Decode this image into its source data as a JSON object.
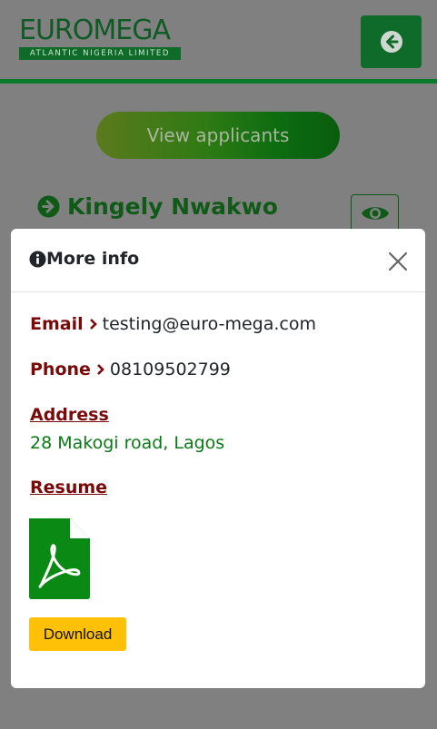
{
  "header": {
    "logo_main_1": "EURO",
    "logo_main_2": "MEGA",
    "logo_sub": "ATLANTIC NIGERIA LIMITED",
    "back_icon": "arrow-left-circle-icon"
  },
  "main": {
    "view_applicants_label": "View applicants",
    "applicant_name": "Kingely Nwakwo",
    "applicant_icon": "arrow-right-circle-icon",
    "view_icon": "eye-icon"
  },
  "modal": {
    "title": "More info",
    "title_icon": "info-circle-icon",
    "close_icon": "close-icon",
    "email_label": "Email",
    "email_value": "testing@euro-mega.com",
    "phone_label": "Phone",
    "phone_value": "08109502799",
    "address_label": "Address",
    "address_value": "28 Makogi road, Lagos",
    "resume_label": "Resume",
    "resume_icon": "pdf-file-icon",
    "download_label": "Download"
  },
  "colors": {
    "brand_green": "#0f6b2a",
    "label_red": "#7a0a0a",
    "address_green": "#0a7a17",
    "download_yellow": "#ffc107"
  }
}
